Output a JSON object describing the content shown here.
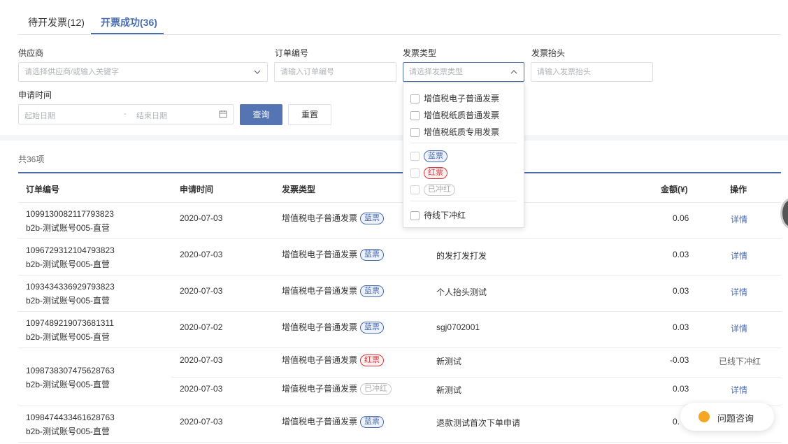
{
  "tabs": [
    {
      "label": "待开发票(12)"
    },
    {
      "label": "开票成功(36)"
    }
  ],
  "filters": {
    "supplier": {
      "label": "供应商",
      "placeholder": "请选择供应商/或输入关键字"
    },
    "order_no": {
      "label": "订单编号",
      "placeholder": "请输入订单编号"
    },
    "invoice_type": {
      "label": "发票类型",
      "placeholder": "请选择发票类型"
    },
    "invoice_title": {
      "label": "发票抬头",
      "placeholder": "请输入发票抬头"
    },
    "apply_time": {
      "label": "申请时间",
      "start_placeholder": "起始日期",
      "separator": "-",
      "end_placeholder": "结束日期"
    },
    "query_label": "查询",
    "reset_label": "重置"
  },
  "dropdown": {
    "options": [
      "增值税电子普通发票",
      "增值税纸质普通发票",
      "增值税纸质专用发票"
    ],
    "badges": [
      "蓝票",
      "红票",
      "已冲红"
    ],
    "extra": "待线下冲红"
  },
  "table": {
    "count": "共36项",
    "headers": [
      "订单编号",
      "申请时间",
      "发票类型",
      "金额(¥)",
      "操作"
    ],
    "rows": [
      {
        "order": "1099130082117793823",
        "account": "b2b-测试账号005-直营",
        "date": "2020-07-03",
        "type": "增值税电子普通发票",
        "badge": "蓝票",
        "title": "",
        "amount": "0.06",
        "action": "详情"
      },
      {
        "order": "1096729312104793823",
        "account": "b2b-测试账号005-直营",
        "date": "2020-07-03",
        "type": "增值税电子普通发票",
        "badge": "蓝票",
        "title": "的发打发打发",
        "amount": "0.03",
        "action": "详情"
      },
      {
        "order": "1093434336929793823",
        "account": "b2b-测试账号005-直营",
        "date": "2020-07-03",
        "type": "增值税电子普通发票",
        "badge": "蓝票",
        "title": "个人抬头测试",
        "amount": "0.03",
        "action": "详情"
      },
      {
        "order": "1097489219073681311",
        "account": "b2b-测试账号005-直营",
        "date": "2020-07-02",
        "type": "增值税电子普通发票",
        "badge": "蓝票",
        "title": "sgj0702001",
        "amount": "0.03",
        "action": "详情"
      },
      {
        "order": "1098738307475628763",
        "account": "b2b-测试账号005-直营",
        "sub": [
          {
            "date": "2020-07-03",
            "type": "增值税电子普通发票",
            "badge": "红票",
            "title": "新测试",
            "amount": "-0.03",
            "action": "已线下冲红"
          },
          {
            "date": "2020-07-03",
            "type": "增值税电子普通发票",
            "badge": "已冲红",
            "title": "新测试",
            "amount": "0.03",
            "action": "详情"
          }
        ]
      },
      {
        "order": "1098474433461628763",
        "account": "b2b-测试账号005-直营",
        "date": "2020-07-03",
        "type": "增值税电子普通发票",
        "badge": "蓝票",
        "title": "退款测试首次下单申请",
        "amount": "0.",
        "action": ""
      }
    ]
  },
  "help": {
    "label": "问题咨询"
  },
  "colors": {
    "accent": "#4a6cad",
    "red": "#d9363e",
    "help_icon": "#f5a623"
  }
}
